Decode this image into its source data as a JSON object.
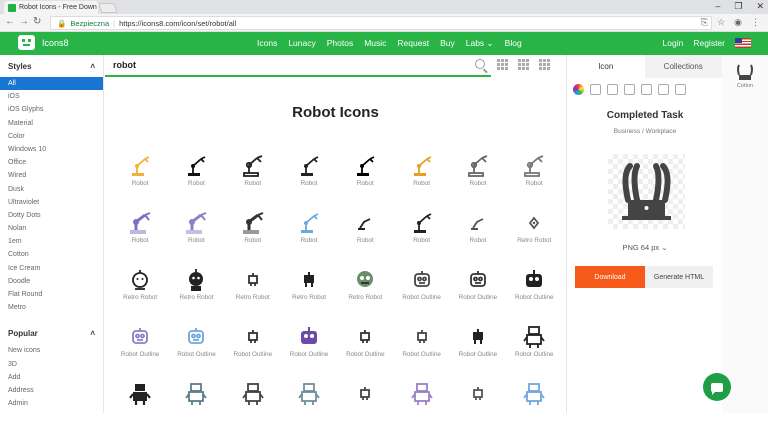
{
  "browser": {
    "tab_title": "Robot Icons - Free Down",
    "secure_label": "Bezpieczna",
    "url": "https://icons8.com/icon/set/robot/all"
  },
  "topnav": {
    "logo": "Icons8",
    "menu": [
      "Icons",
      "Lunacy",
      "Photos",
      "Music",
      "Request",
      "Buy",
      "Labs ⌄",
      "Blog"
    ],
    "login": "Login",
    "register": "Register"
  },
  "sidebar": {
    "styles_heading": "Styles",
    "styles": [
      "All",
      "iOS",
      "iOS Glyphs",
      "Material",
      "Color",
      "Windows 10",
      "Office",
      "Wired",
      "Dusk",
      "Ultraviolet",
      "Dotty Dots",
      "Nolan",
      "1em",
      "Cotton",
      "Ice Cream",
      "Doodle",
      "Flat Round",
      "Metro"
    ],
    "popular_heading": "Popular",
    "popular": [
      "New icons",
      "3D",
      "Add",
      "Address",
      "Admin"
    ]
  },
  "main": {
    "search_value": "robot",
    "title": "Robot Icons",
    "icons": [
      {
        "label": "Robot",
        "kind": "arm",
        "color": "#f2b134"
      },
      {
        "label": "Robot",
        "kind": "arm",
        "color": "#111"
      },
      {
        "label": "Robot",
        "kind": "arm-outline",
        "color": "#222"
      },
      {
        "label": "Robot",
        "kind": "arm",
        "color": "#222"
      },
      {
        "label": "Robot",
        "kind": "arm",
        "color": "#000"
      },
      {
        "label": "Robot",
        "kind": "arm",
        "color": "#e0a21b"
      },
      {
        "label": "Robot",
        "kind": "arm-outline",
        "color": "#666"
      },
      {
        "label": "Robot",
        "kind": "arm-outline",
        "color": "#777"
      },
      {
        "label": "Robot",
        "kind": "arm-big",
        "color": "#7b6fc6"
      },
      {
        "label": "Robot",
        "kind": "arm-big",
        "color": "#8a7fc8"
      },
      {
        "label": "Robot",
        "kind": "arm-big",
        "color": "#333"
      },
      {
        "label": "Robot",
        "kind": "arm",
        "color": "#6fa8dc"
      },
      {
        "label": "Robot",
        "kind": "arm-small",
        "color": "#222"
      },
      {
        "label": "Robot",
        "kind": "arm",
        "color": "#222"
      },
      {
        "label": "Robot",
        "kind": "arm-small",
        "color": "#555"
      },
      {
        "label": "Retro Robot",
        "kind": "diamond",
        "color": "#555"
      },
      {
        "label": "Retro Robot",
        "kind": "head-outline",
        "color": "#222"
      },
      {
        "label": "Retro Robot",
        "kind": "head-filled",
        "color": "#222"
      },
      {
        "label": "Retro Robot",
        "kind": "small",
        "color": "#333"
      },
      {
        "label": "Retro Robot",
        "kind": "small-filled",
        "color": "#222"
      },
      {
        "label": "Retro Robot",
        "kind": "head-color",
        "color": "#6b8e6b"
      },
      {
        "label": "Robot Outline",
        "kind": "bot-outline",
        "color": "#444"
      },
      {
        "label": "Robot Outline",
        "kind": "bot-outline",
        "color": "#333"
      },
      {
        "label": "Robot Outline",
        "kind": "bot-filled",
        "color": "#222"
      },
      {
        "label": "Robot Outline",
        "kind": "bot-outline",
        "color": "#8e7cc3"
      },
      {
        "label": "Robot Outline",
        "kind": "bot-outline",
        "color": "#6fa8dc"
      },
      {
        "label": "Robot Outline",
        "kind": "small",
        "color": "#333"
      },
      {
        "label": "Robot Outline",
        "kind": "bot-filled",
        "color": "#6d4aa8"
      },
      {
        "label": "Robot Outline",
        "kind": "small",
        "color": "#333"
      },
      {
        "label": "Robot Outline",
        "kind": "small",
        "color": "#444"
      },
      {
        "label": "Robot Outline",
        "kind": "small-filled",
        "color": "#222"
      },
      {
        "label": "Robot Outline",
        "kind": "body",
        "color": "#222"
      },
      {
        "label": "",
        "kind": "body-filled",
        "color": "#222"
      },
      {
        "label": "",
        "kind": "body",
        "color": "#5c7d8a"
      },
      {
        "label": "",
        "kind": "body",
        "color": "#444"
      },
      {
        "label": "",
        "kind": "body",
        "color": "#6f8fa0"
      },
      {
        "label": "",
        "kind": "small",
        "color": "#444"
      },
      {
        "label": "",
        "kind": "body",
        "color": "#9a7fc8"
      },
      {
        "label": "",
        "kind": "small",
        "color": "#555"
      },
      {
        "label": "",
        "kind": "body",
        "color": "#6fa8dc"
      }
    ]
  },
  "detail": {
    "tab_icon": "Icon",
    "tab_collections": "Collections",
    "name": "Completed Task",
    "category": "Business / Workplace",
    "format": "PNG 64 px ⌄",
    "download": "Download",
    "generate": "Generate HTML"
  },
  "far_right": {
    "label": "Cotton"
  },
  "colors": {
    "brand": "#28b446",
    "accent_blue": "#1976d2",
    "download": "#f55a1a"
  }
}
